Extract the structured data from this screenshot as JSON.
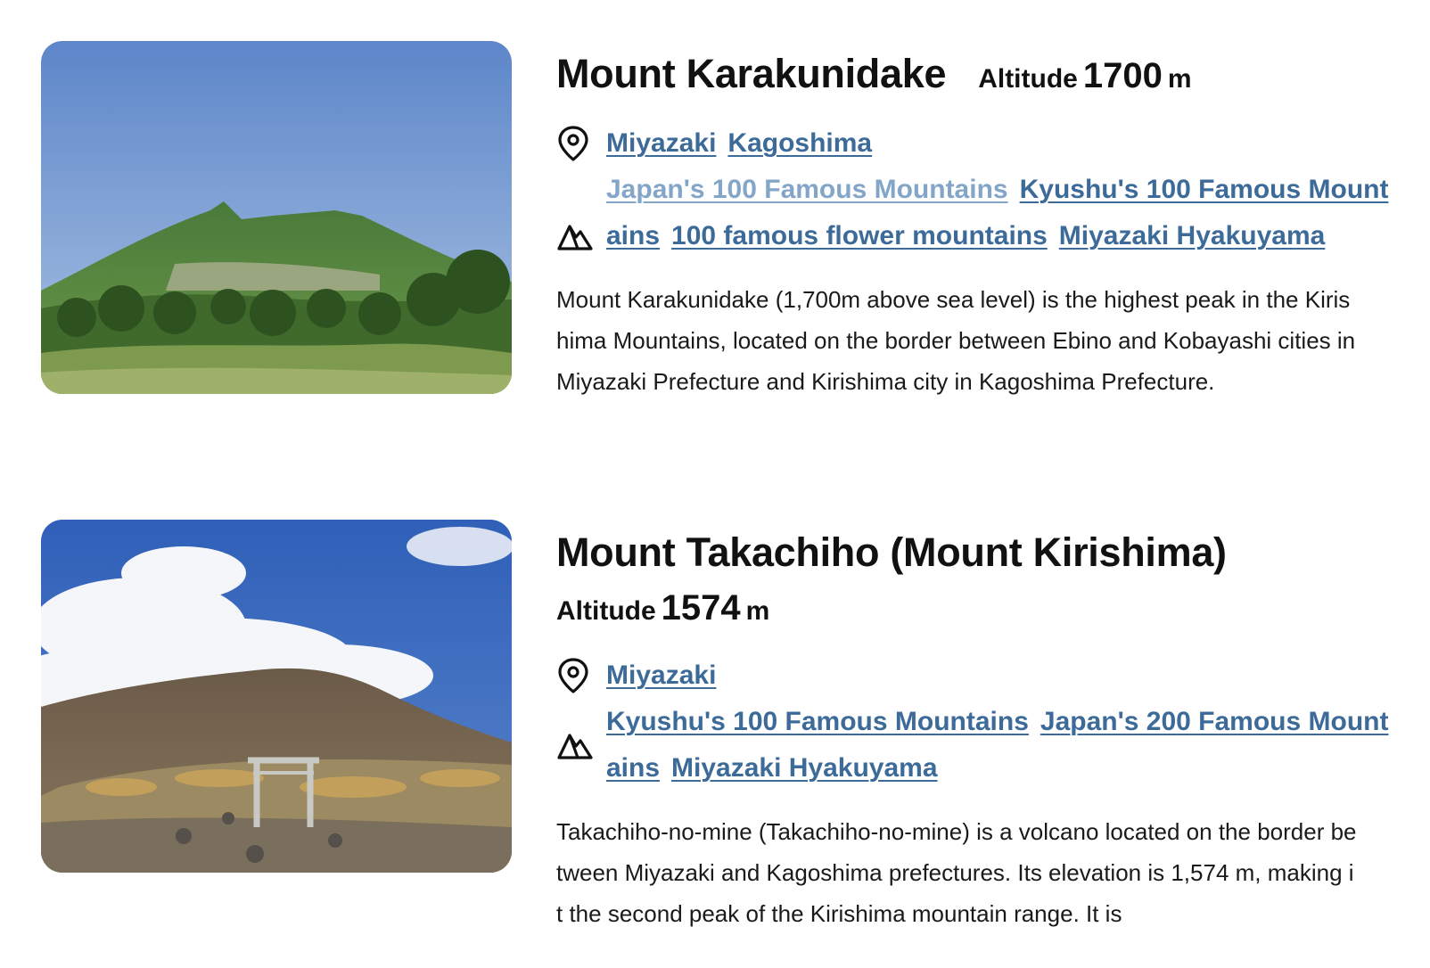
{
  "colors": {
    "link": "#3d6b99",
    "link_faded": "#83a6c8",
    "text": "#111111"
  },
  "mountains": [
    {
      "title": "Mount Karakunidake",
      "altitude_label": "Altitude",
      "altitude_value": "1700",
      "altitude_unit": "m",
      "locations": [
        "Miyazaki",
        "Kagoshima"
      ],
      "categories": [
        "Japan's 100 Famous Mountains",
        "Kyushu's 100 Famous Mountains",
        "100 famous flower mountains",
        "Miyazaki Hyakuyama"
      ],
      "description": "Mount Karakunidake (1,700m above sea level) is the highest peak in the Kirishima Mountains, located on the border between Ebino and Kobayashi cities in Miyazaki Prefecture and Kirishima city in Kagoshima Prefecture.",
      "icons": {
        "location": "map-pin-icon",
        "category": "mountain-icon"
      }
    },
    {
      "title": "Mount Takachiho (Mount Kirishima)",
      "altitude_label": "Altitude",
      "altitude_value": "1574",
      "altitude_unit": "m",
      "locations": [
        "Miyazaki"
      ],
      "categories": [
        "Kyushu's 100 Famous Mountains",
        "Japan's 200 Famous Mountains",
        "Miyazaki Hyakuyama"
      ],
      "description": "Takachiho-no-mine (Takachiho-no-mine) is a volcano located on the border between Miyazaki and Kagoshima prefectures. Its elevation is 1,574 m, making it the second peak of the Kirishima mountain range. It is",
      "icons": {
        "location": "map-pin-icon",
        "category": "mountain-icon"
      }
    }
  ]
}
